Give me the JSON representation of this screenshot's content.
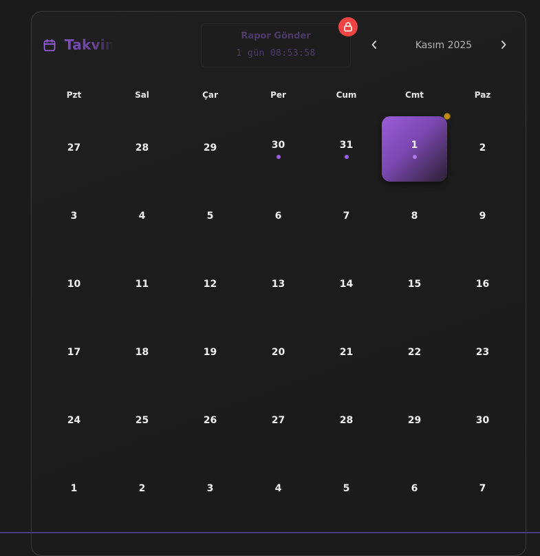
{
  "header": {
    "title": "Takvim",
    "report_button": {
      "label": "Rapor Gönder",
      "countdown": "1 gün 08:53:58"
    },
    "month_label": "Kasım 2025"
  },
  "weekdays": [
    "Pzt",
    "Sal",
    "Çar",
    "Per",
    "Cum",
    "Cmt",
    "Paz"
  ],
  "weeks": [
    [
      {
        "num": "27",
        "dot": false,
        "selected": false
      },
      {
        "num": "28",
        "dot": false,
        "selected": false
      },
      {
        "num": "29",
        "dot": false,
        "selected": false
      },
      {
        "num": "30",
        "dot": true,
        "selected": false
      },
      {
        "num": "31",
        "dot": true,
        "selected": false
      },
      {
        "num": "1",
        "dot": true,
        "selected": true,
        "today_marker": true
      },
      {
        "num": "2",
        "dot": false,
        "selected": false
      }
    ],
    [
      {
        "num": "3"
      },
      {
        "num": "4"
      },
      {
        "num": "5"
      },
      {
        "num": "6"
      },
      {
        "num": "7"
      },
      {
        "num": "8"
      },
      {
        "num": "9"
      }
    ],
    [
      {
        "num": "10"
      },
      {
        "num": "11"
      },
      {
        "num": "12"
      },
      {
        "num": "13"
      },
      {
        "num": "14"
      },
      {
        "num": "15"
      },
      {
        "num": "16"
      }
    ],
    [
      {
        "num": "17"
      },
      {
        "num": "18"
      },
      {
        "num": "19"
      },
      {
        "num": "20"
      },
      {
        "num": "21"
      },
      {
        "num": "22"
      },
      {
        "num": "23"
      }
    ],
    [
      {
        "num": "24"
      },
      {
        "num": "25"
      },
      {
        "num": "26"
      },
      {
        "num": "27"
      },
      {
        "num": "28"
      },
      {
        "num": "29"
      },
      {
        "num": "30"
      }
    ],
    [
      {
        "num": "1"
      },
      {
        "num": "2"
      },
      {
        "num": "3"
      },
      {
        "num": "4"
      },
      {
        "num": "5"
      },
      {
        "num": "6"
      },
      {
        "num": "7"
      }
    ]
  ],
  "colors": {
    "accent": "#9b5de5",
    "lock_badge": "#ef4444",
    "today_marker": "#c08a18",
    "background": "#1b1b1b"
  },
  "icons": {
    "title": "calendar-icon",
    "report_badge": "lock-icon",
    "prev": "chevron-left-icon",
    "next": "chevron-right-icon"
  }
}
